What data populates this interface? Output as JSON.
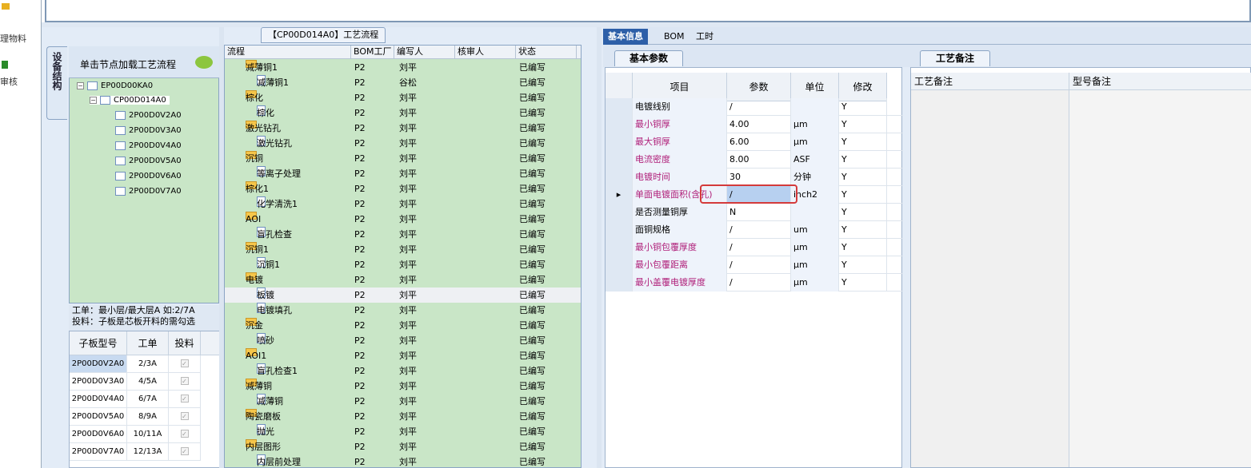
{
  "toolbar_left": {
    "item1": "理物料",
    "item2": "审核"
  },
  "process_panel": {
    "title": "【CP00D014A0】工艺流程"
  },
  "device_tab": "设备结构",
  "tree": {
    "hint": "单击节点加载工艺流程",
    "root": "EP00D00KA0",
    "child": "CP00D014A0",
    "leaves": [
      "2P00D0V2A0",
      "2P00D0V3A0",
      "2P00D0V4A0",
      "2P00D0V5A0",
      "2P00D0V6A0",
      "2P00D0V7A0"
    ]
  },
  "note": {
    "line1": "工单：最小层/最大层A 如:2/7A",
    "line2": "投料：子板是芯板开料的需勾选"
  },
  "subboard": {
    "headers": [
      "子板型号",
      "工单",
      "投料"
    ],
    "rows": [
      {
        "model": "2P00D0V2A0",
        "order": "2/3A"
      },
      {
        "model": "2P00D0V3A0",
        "order": "4/5A"
      },
      {
        "model": "2P00D0V4A0",
        "order": "6/7A"
      },
      {
        "model": "2P00D0V5A0",
        "order": "8/9A"
      },
      {
        "model": "2P00D0V6A0",
        "order": "10/11A"
      },
      {
        "model": "2P00D0V7A0",
        "order": "12/13A"
      }
    ]
  },
  "flow": {
    "headers": [
      "流程",
      "BOM工厂",
      "编写人",
      "核审人",
      "状态"
    ],
    "rows": [
      {
        "name": "减薄铜1",
        "level": 1,
        "bom": "P2",
        "writer": "刘平",
        "status": "已编写"
      },
      {
        "name": "减薄铜1",
        "level": 2,
        "bom": "P2",
        "writer": "谷松",
        "status": "已编写"
      },
      {
        "name": "棕化",
        "level": 1,
        "bom": "P2",
        "writer": "刘平",
        "status": "已编写"
      },
      {
        "name": "棕化",
        "level": 2,
        "bom": "P2",
        "writer": "刘平",
        "status": "已编写"
      },
      {
        "name": "激光钻孔",
        "level": 1,
        "bom": "P2",
        "writer": "刘平",
        "status": "已编写"
      },
      {
        "name": "激光钻孔",
        "level": 2,
        "bom": "P2",
        "writer": "刘平",
        "status": "已编写"
      },
      {
        "name": "沉铜",
        "level": 1,
        "bom": "P2",
        "writer": "刘平",
        "status": "已编写"
      },
      {
        "name": "等离子处理",
        "level": 2,
        "bom": "P2",
        "writer": "刘平",
        "status": "已编写"
      },
      {
        "name": "棕化1",
        "level": 1,
        "bom": "P2",
        "writer": "刘平",
        "status": "已编写"
      },
      {
        "name": "化学清洗1",
        "level": 2,
        "bom": "P2",
        "writer": "刘平",
        "status": "已编写"
      },
      {
        "name": "AOI",
        "level": 1,
        "bom": "P2",
        "writer": "刘平",
        "status": "已编写"
      },
      {
        "name": "盲孔检查",
        "level": 2,
        "bom": "P2",
        "writer": "刘平",
        "status": "已编写"
      },
      {
        "name": "沉铜1",
        "level": 1,
        "bom": "P2",
        "writer": "刘平",
        "status": "已编写"
      },
      {
        "name": "沉铜1",
        "level": 2,
        "bom": "P2",
        "writer": "刘平",
        "status": "已编写"
      },
      {
        "name": "电镀",
        "level": 1,
        "bom": "P2",
        "writer": "刘平",
        "status": "已编写"
      },
      {
        "name": "板镀",
        "level": 2,
        "bom": "P2",
        "writer": "刘平",
        "status": "已编写"
      },
      {
        "name": "电镀填孔",
        "level": 2,
        "bom": "P2",
        "writer": "刘平",
        "status": "已编写"
      },
      {
        "name": "沉金",
        "level": 1,
        "bom": "P2",
        "writer": "刘平",
        "status": "已编写"
      },
      {
        "name": "喷砂",
        "level": 2,
        "bom": "P2",
        "writer": "刘平",
        "status": "已编写"
      },
      {
        "name": "AOI1",
        "level": 1,
        "bom": "P2",
        "writer": "刘平",
        "status": "已编写"
      },
      {
        "name": "盲孔检查1",
        "level": 2,
        "bom": "P2",
        "writer": "刘平",
        "status": "已编写"
      },
      {
        "name": "减薄铜",
        "level": 1,
        "bom": "P2",
        "writer": "刘平",
        "status": "已编写"
      },
      {
        "name": "减薄铜",
        "level": 2,
        "bom": "P2",
        "writer": "刘平",
        "status": "已编写"
      },
      {
        "name": "陶瓷磨板",
        "level": 1,
        "bom": "P2",
        "writer": "刘平",
        "status": "已编写"
      },
      {
        "name": "抛光",
        "level": 2,
        "bom": "P2",
        "writer": "刘平",
        "status": "已编写"
      },
      {
        "name": "内层图形",
        "level": 1,
        "bom": "P2",
        "writer": "刘平",
        "status": "已编写"
      },
      {
        "name": "内层前处理",
        "level": 2,
        "bom": "P2",
        "writer": "刘平",
        "status": "已编写"
      }
    ]
  },
  "right_tabs": [
    "基本信息",
    "BOM",
    "工时"
  ],
  "basic_params": {
    "subtab": "基本参数",
    "headers": [
      "项目",
      "参数",
      "单位",
      "修改"
    ],
    "rows": [
      {
        "item": "电镀线别",
        "value": "/",
        "unit": "",
        "edit": "Y",
        "color": "#000000"
      },
      {
        "item": "最小铜厚",
        "value": "4.00",
        "unit": "μm",
        "edit": "Y",
        "color": "#b0207a"
      },
      {
        "item": "最大铜厚",
        "value": "6.00",
        "unit": "μm",
        "edit": "Y",
        "color": "#b0207a"
      },
      {
        "item": "电流密度",
        "value": "8.00",
        "unit": "ASF",
        "edit": "Y",
        "color": "#b0207a"
      },
      {
        "item": "电镀时间",
        "value": "30",
        "unit": "分钟",
        "edit": "Y",
        "color": "#b0207a"
      },
      {
        "item": "单面电镀面积(含孔)",
        "value": "/",
        "unit": "inch2",
        "edit": "Y",
        "color": "#b0207a"
      },
      {
        "item": "是否测量铜厚",
        "value": "N",
        "unit": "",
        "edit": "Y",
        "color": "#000000"
      },
      {
        "item": "面铜规格",
        "value": "/",
        "unit": "um",
        "edit": "Y",
        "color": "#000000"
      },
      {
        "item": "最小铜包覆厚度",
        "value": "/",
        "unit": "μm",
        "edit": "Y",
        "color": "#b0207a"
      },
      {
        "item": "最小包覆距离",
        "value": "/",
        "unit": "μm",
        "edit": "Y",
        "color": "#b0207a"
      },
      {
        "item": "最小盖覆电镀厚度",
        "value": "/",
        "unit": "μm",
        "edit": "Y",
        "color": "#b0207a"
      }
    ]
  },
  "process_notes": {
    "subtab": "工艺备注",
    "col1": "工艺备注",
    "col2": "型号备注"
  }
}
